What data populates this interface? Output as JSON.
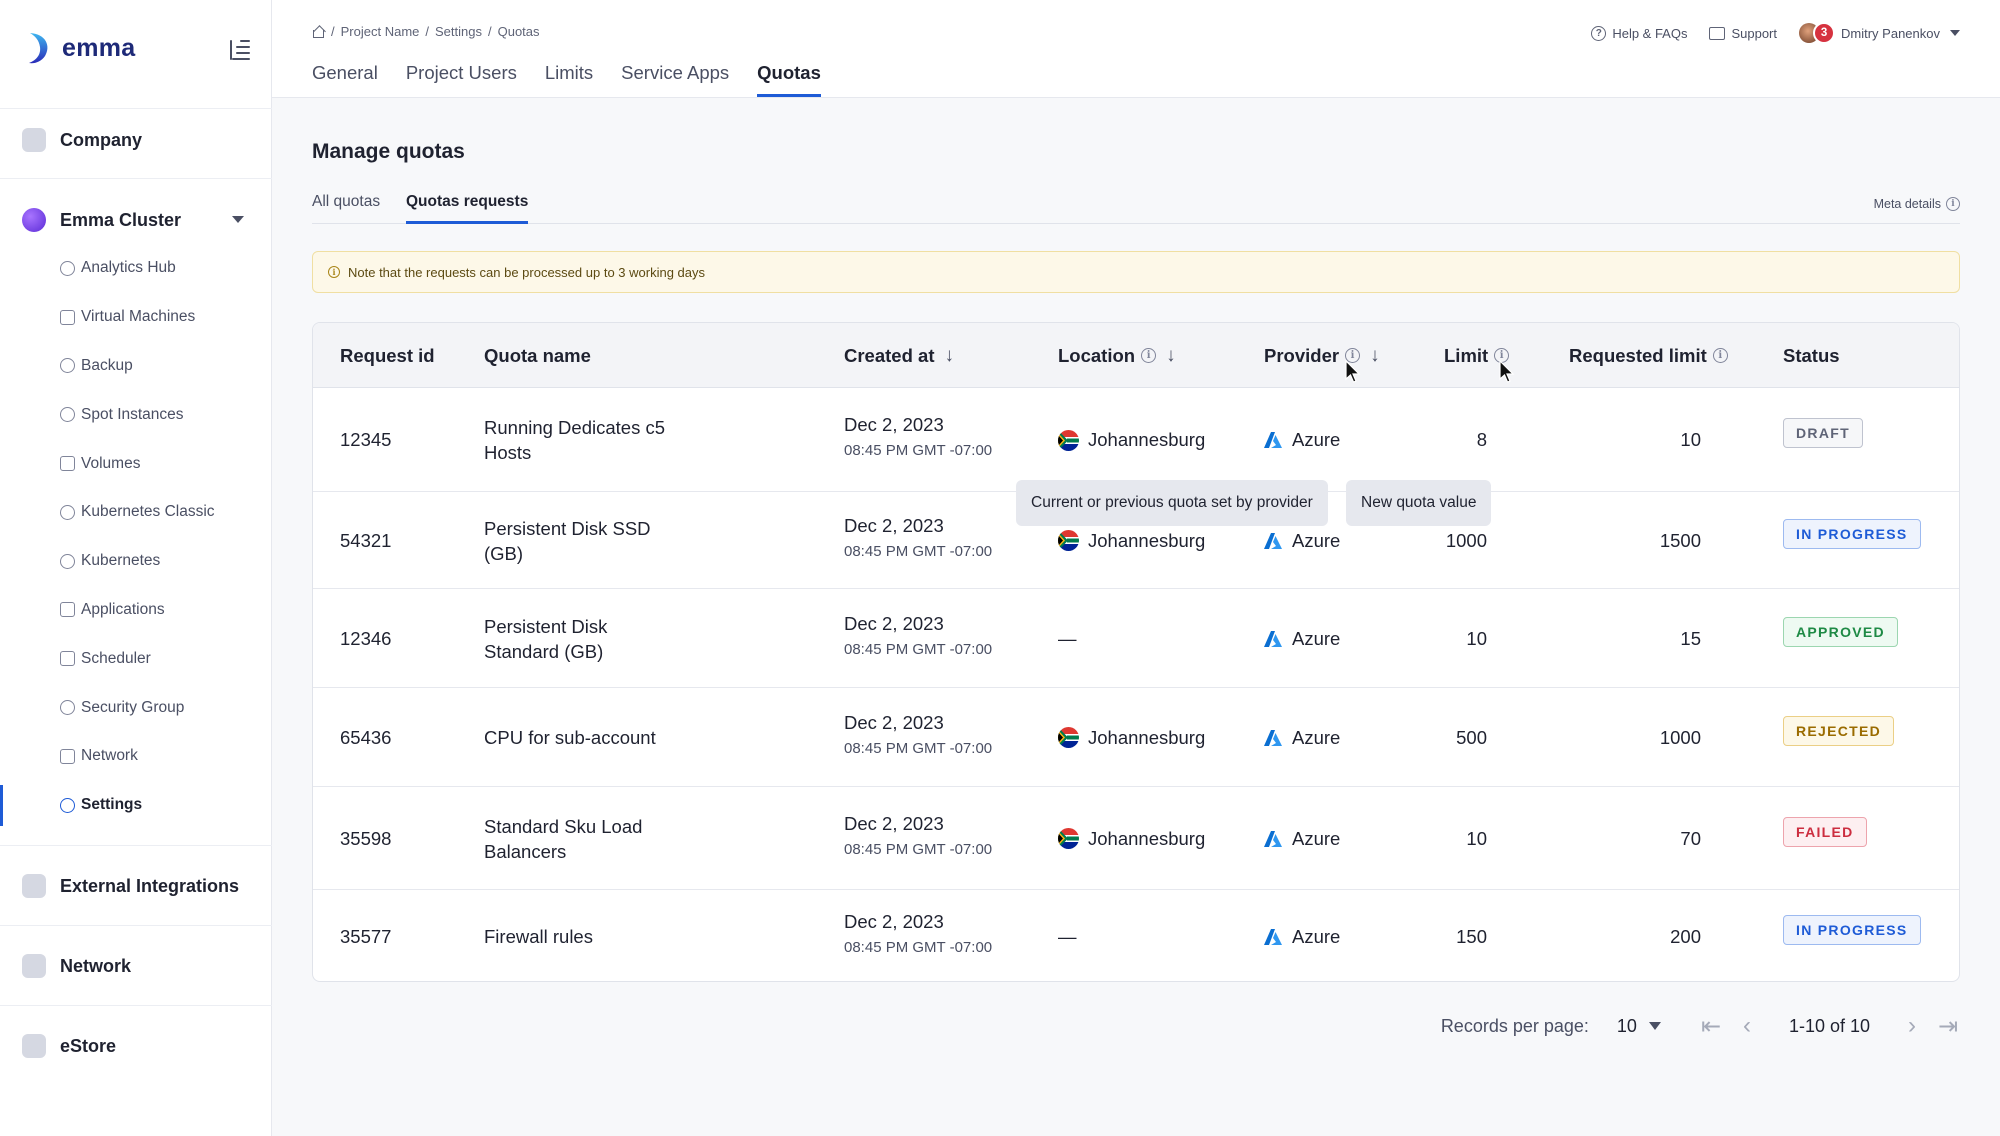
{
  "brand": {
    "name": "emma"
  },
  "sidebar": {
    "sections": [
      {
        "label": "Company"
      },
      {
        "label": "Emma Cluster"
      },
      {
        "label": "External Integrations"
      },
      {
        "label": "Network"
      },
      {
        "label": "eStore"
      }
    ],
    "items": [
      {
        "label": "Analytics Hub",
        "icon": "gauge-icon"
      },
      {
        "label": "Virtual Machines",
        "icon": "server-icon"
      },
      {
        "label": "Backup",
        "icon": "history-icon"
      },
      {
        "label": "Spot Instances",
        "icon": "clock-icon"
      },
      {
        "label": "Volumes",
        "icon": "drive-icon"
      },
      {
        "label": "Kubernetes Classic",
        "icon": "helm-icon"
      },
      {
        "label": "Kubernetes",
        "icon": "helm-icon"
      },
      {
        "label": "Applications",
        "icon": "cube-icon"
      },
      {
        "label": "Scheduler",
        "icon": "calendar-icon"
      },
      {
        "label": "Security Group",
        "icon": "shield-icon"
      },
      {
        "label": "Network",
        "icon": "network-icon"
      },
      {
        "label": "Settings",
        "icon": "gear-icon",
        "active": true
      }
    ]
  },
  "header": {
    "breadcrumb": [
      "Project Name",
      "Settings",
      "Quotas"
    ],
    "tabs": [
      "General",
      "Project Users",
      "Limits",
      "Service Apps",
      "Quotas"
    ],
    "active_tab": "Quotas",
    "help_label": "Help & FAQs",
    "support_label": "Support",
    "notification_count": "3",
    "user_name": "Dmitry Panenkov"
  },
  "main": {
    "title": "Manage quotas",
    "subtabs": [
      "All quotas",
      "Quotas requests"
    ],
    "active_subtab": "Quotas requests",
    "meta_label": "Meta details",
    "note": "Note that the requests can be processed up to 3 working days",
    "columns": {
      "request_id": "Request id",
      "quota_name": "Quota name",
      "created_at": "Created at",
      "location": "Location",
      "provider": "Provider",
      "limit": "Limit",
      "requested_limit": "Requested limit",
      "status": "Status"
    },
    "tooltips": {
      "limit": "Current or previous quota set by provider",
      "requested_limit": "New quota value"
    },
    "rows": [
      {
        "id": "12345",
        "name": "Running Dedicates c5 Hosts",
        "date": "Dec 2, 2023",
        "time": "08:45 PM GMT -07:00",
        "location": "Johannesburg",
        "provider": "Azure",
        "limit": "8",
        "requested": "10",
        "status": "DRAFT"
      },
      {
        "id": "54321",
        "name": "Persistent Disk SSD (GB)",
        "date": "Dec 2, 2023",
        "time": "08:45 PM GMT -07:00",
        "location": "Johannesburg",
        "provider": "Azure",
        "limit": "1000",
        "requested": "1500",
        "status": "IN PROGRESS"
      },
      {
        "id": "12346",
        "name": "Persistent Disk Standard (GB)",
        "date": "Dec 2, 2023",
        "time": "08:45 PM GMT -07:00",
        "location": "—",
        "provider": "Azure",
        "limit": "10",
        "requested": "15",
        "status": "APPROVED"
      },
      {
        "id": "65436",
        "name": "CPU for sub-account",
        "date": "Dec 2, 2023",
        "time": "08:45 PM GMT -07:00",
        "location": "Johannesburg",
        "provider": "Azure",
        "limit": "500",
        "requested": "1000",
        "status": "REJECTED"
      },
      {
        "id": "35598",
        "name": "Standard Sku Load Balancers",
        "date": "Dec 2, 2023",
        "time": "08:45 PM GMT -07:00",
        "location": "Johannesburg",
        "provider": "Azure",
        "limit": "10",
        "requested": "70",
        "status": "FAILED"
      },
      {
        "id": "35577",
        "name": "Firewall rules",
        "date": "Dec 2, 2023",
        "time": "08:45 PM GMT -07:00",
        "location": "—",
        "provider": "Azure",
        "limit": "150",
        "requested": "200",
        "status": "IN PROGRESS"
      }
    ],
    "pagination": {
      "records_label": "Records per page:",
      "per_page": "10",
      "range": "1-10 of 10"
    }
  },
  "colors": {
    "accent": "#1e5bd6",
    "draft": "#5f6477",
    "in_progress": "#1e5bd6",
    "approved": "#1e8a45",
    "rejected": "#9a6b00",
    "failed": "#cc2d3f"
  }
}
